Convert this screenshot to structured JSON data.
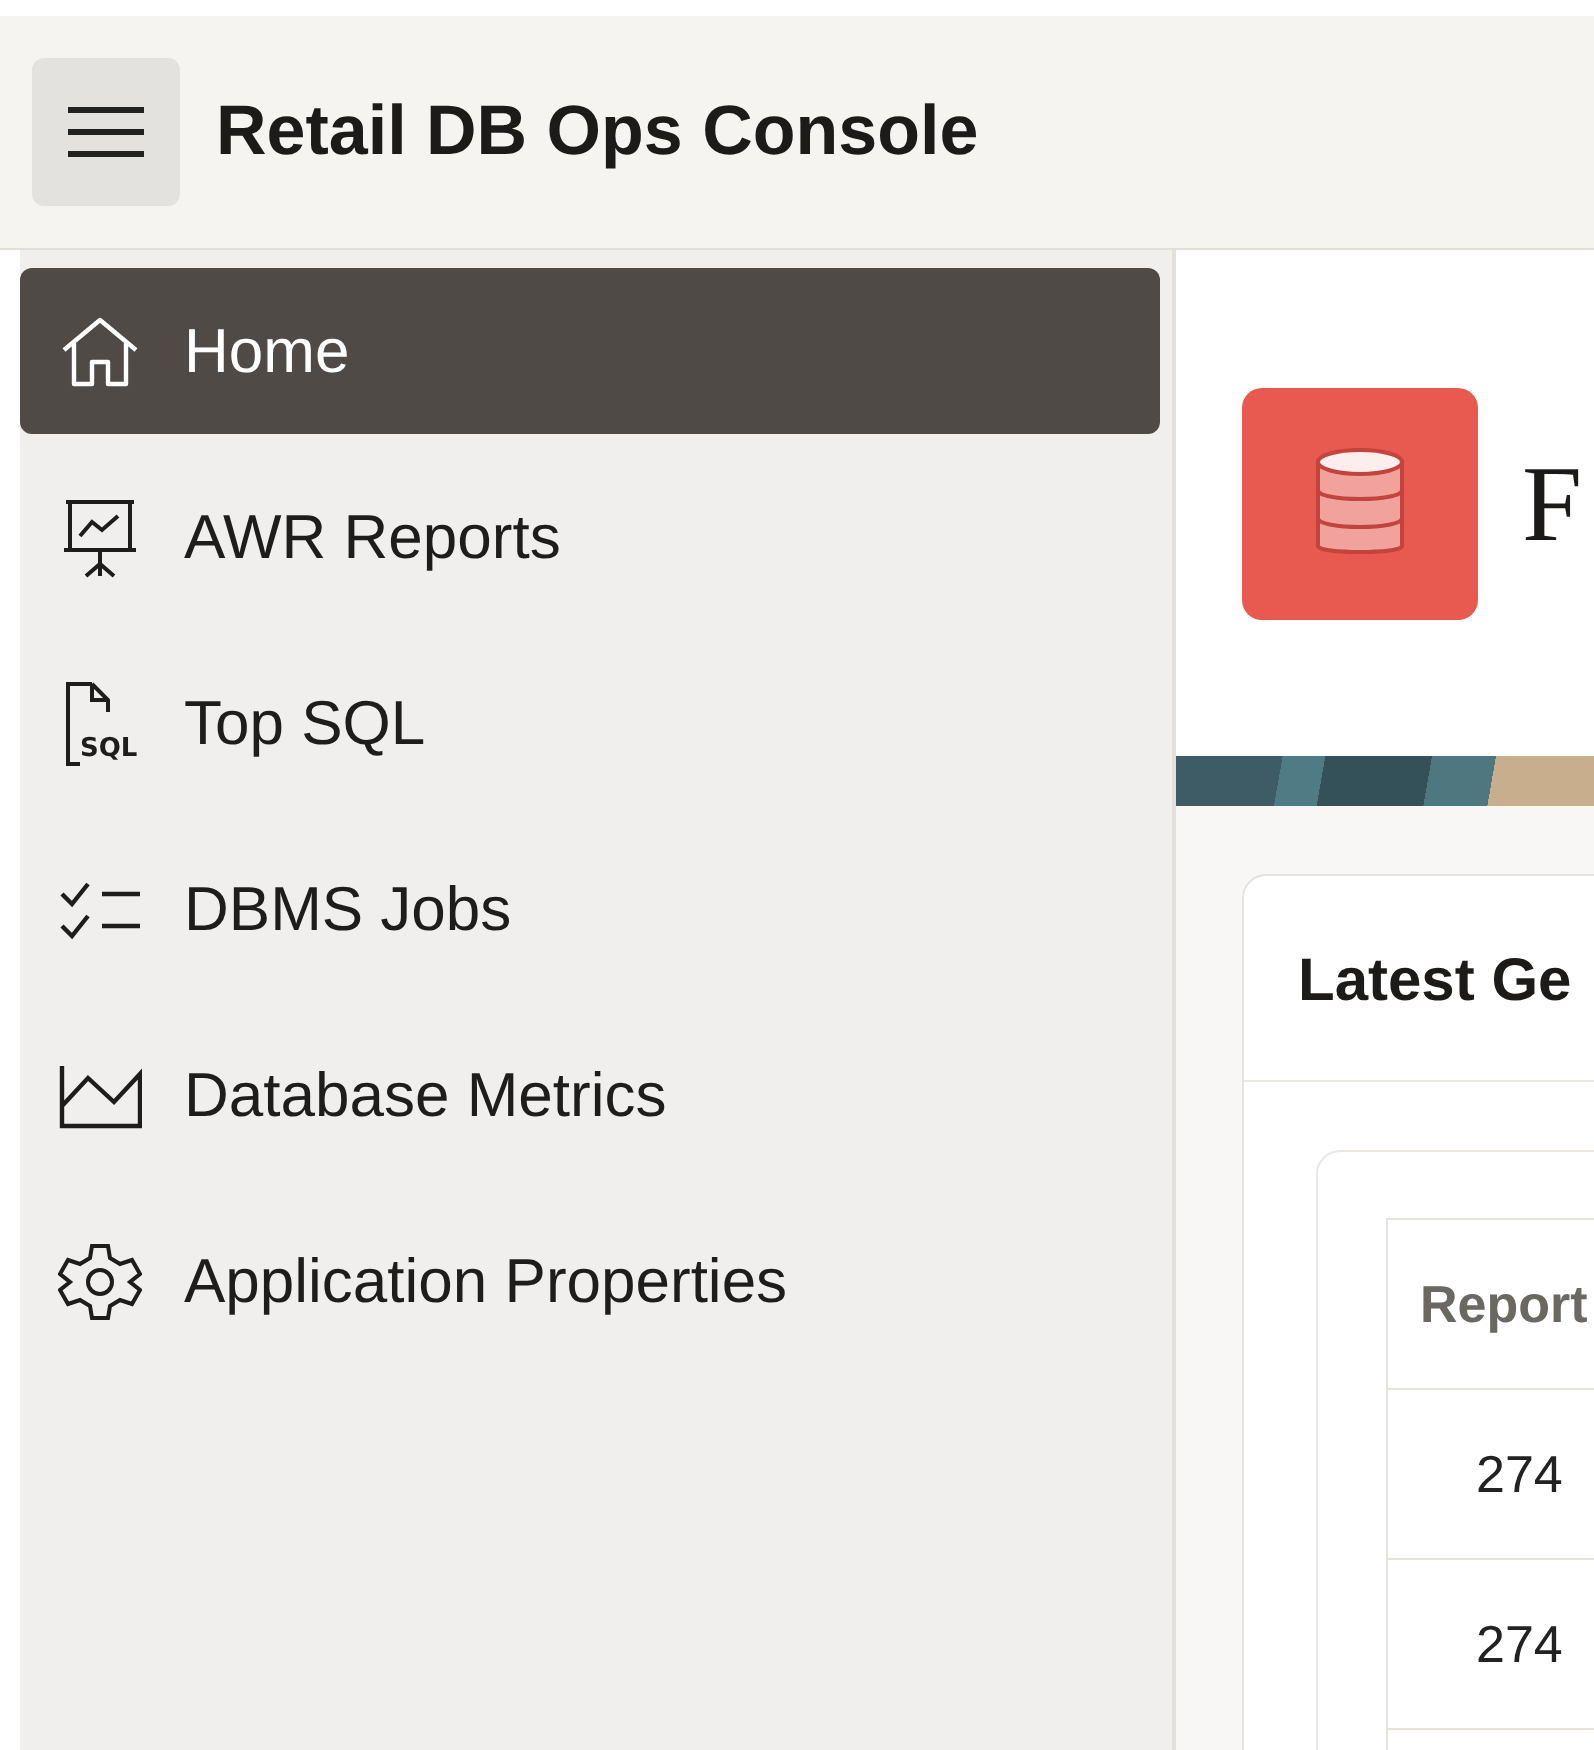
{
  "header": {
    "title": "Retail DB Ops Console"
  },
  "sidebar": {
    "items": [
      {
        "label": "Home",
        "selected": true
      },
      {
        "label": "AWR Reports",
        "selected": false
      },
      {
        "label": "Top SQL",
        "icon_text": "SQL",
        "selected": false
      },
      {
        "label": "DBMS Jobs",
        "selected": false
      },
      {
        "label": "Database Metrics",
        "selected": false
      },
      {
        "label": "Application Properties",
        "selected": false
      }
    ]
  },
  "hero": {
    "title": "F"
  },
  "card": {
    "title": "Latest Ge",
    "table": {
      "columns": [
        "Report"
      ],
      "rows": [
        [
          "274"
        ],
        [
          "274"
        ],
        [
          ""
        ]
      ]
    }
  }
}
